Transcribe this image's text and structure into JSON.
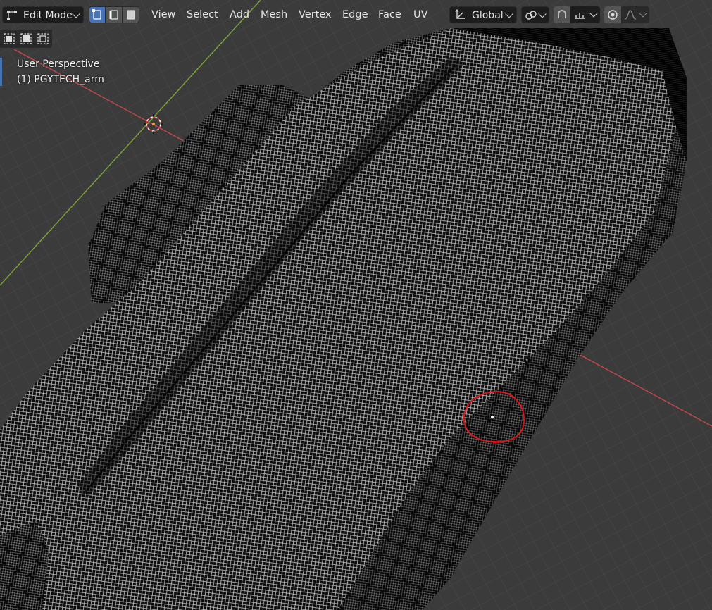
{
  "header": {
    "mode_label": "Edit Mode",
    "menus": [
      "View",
      "Select",
      "Add",
      "Mesh",
      "Vertex",
      "Edge",
      "Face",
      "UV"
    ],
    "transform_orientation": "Global"
  },
  "overlay": {
    "view_name": "User Perspective",
    "object_name": "(1) PGYTECH_arm"
  },
  "colors": {
    "accent": "#4772b3",
    "x_axis": "#c8484d",
    "y_axis": "#7ea53a",
    "annotation": "#e0151c"
  }
}
